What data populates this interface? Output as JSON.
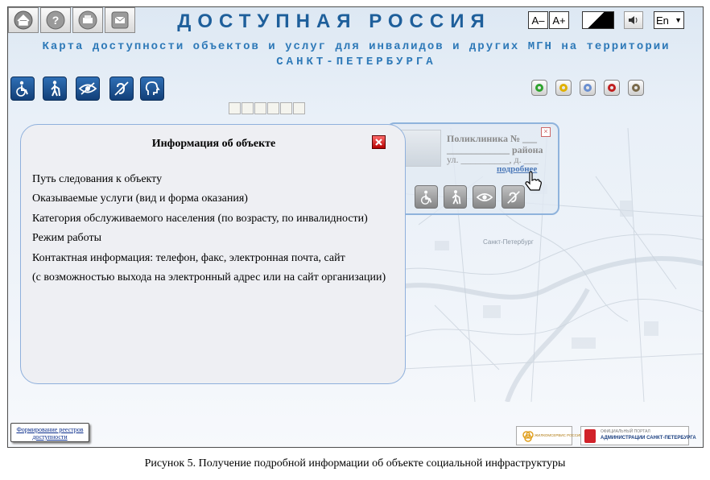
{
  "header": {
    "title": "ДОСТУПНАЯ РОССИЯ",
    "subtitle_line1": "Карта доступности объектов и услуг для инвалидов и других МГН на территории",
    "subtitle_line2": "САНКТ-ПЕТЕРБУРГА",
    "toolbar": [
      {
        "icon": "home-icon"
      },
      {
        "icon": "help-icon"
      },
      {
        "icon": "print-icon"
      },
      {
        "icon": "mail-icon"
      }
    ],
    "font_decrease": "A–",
    "font_increase": "A+",
    "language": "En"
  },
  "categories": [
    {
      "icon": "wheelchair-icon"
    },
    {
      "icon": "person-cane-icon"
    },
    {
      "icon": "eye-icon"
    },
    {
      "icon": "ear-icon"
    },
    {
      "icon": "head-icon"
    }
  ],
  "rings": [
    {
      "color": "#2fa32f"
    },
    {
      "color": "#e0b000"
    },
    {
      "color": "#6a8fd0"
    },
    {
      "color": "#c02020"
    },
    {
      "color": "#7a6a4a"
    }
  ],
  "map_popup": {
    "title": "Поликлиника № ___",
    "line2": "_____________ района",
    "line3": "ул. __________, д. ___",
    "link": "подробнее"
  },
  "info_panel": {
    "title": "Информация об объекте",
    "items": [
      "Путь следования к объекту",
      "Оказываемые услуги (вид и форма оказания)",
      "Категория обслуживаемого населения (по возрасту, по инвалидности)",
      "Режим работы",
      "Контактная информация: телефон, факс, электронная почта, сайт",
      "(с возможностью выхода на электронный адрес или на сайт организации)"
    ]
  },
  "map_label": "Санкт-Петербург",
  "footer": {
    "link_line1": "Формирование реестров",
    "link_line2": "доступности",
    "logo1": "ЖИЛКОМСЕРВИС РОССИИ",
    "logo2_line1": "ОФИЦИАЛЬНЫЙ ПОРТАЛ",
    "logo2_line2": "АДМИНИСТРАЦИИ САНКТ-ПЕТЕРБУРГА"
  },
  "caption": "Рисунок 5. Получение подробной информации об объекте социальной инфраструктуры"
}
